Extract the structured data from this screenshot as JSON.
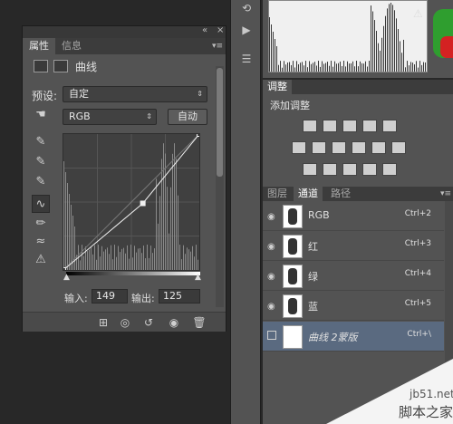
{
  "properties_panel": {
    "tabs": [
      "属性",
      "信息"
    ],
    "collapse_icon": "double-chevron-left-icon",
    "close_icon": "close-icon",
    "adjustment_title": "曲线",
    "preset_label": "预设:",
    "preset_value": "自定",
    "channel_value": "RGB",
    "auto_button": "自动",
    "input_label": "输入:",
    "input_value": "149",
    "output_label": "输出:",
    "output_value": "125",
    "curve": {
      "points": [
        [
          0,
          0
        ],
        [
          149,
          125
        ],
        [
          255,
          255
        ]
      ]
    }
  },
  "adjustments_panel": {
    "tab": "调整",
    "title": "添加调整"
  },
  "layers_panel": {
    "tabs": [
      "图层",
      "通道",
      "路径"
    ],
    "active_tab": "通道",
    "rows": [
      {
        "name": "RGB",
        "shortcut": "Ctrl+2"
      },
      {
        "name": "红",
        "shortcut": "Ctrl+3"
      },
      {
        "name": "绿",
        "shortcut": "Ctrl+4"
      },
      {
        "name": "蓝",
        "shortcut": "Ctrl+5"
      },
      {
        "name": "曲线 2蒙版",
        "shortcut": "Ctrl+\\"
      }
    ]
  },
  "watermark": {
    "site": "jb51.net",
    "name": "脚本之家"
  }
}
